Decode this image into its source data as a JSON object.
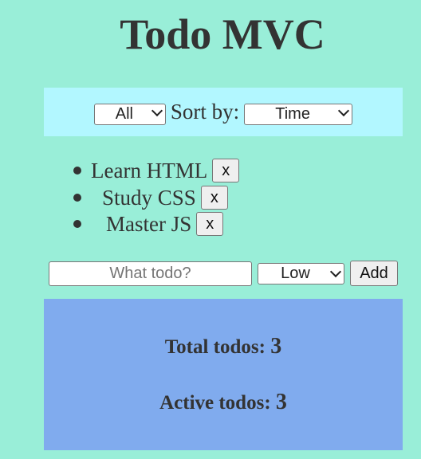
{
  "app": {
    "title": "Todo MVC"
  },
  "filter": {
    "selected": "All",
    "sort_label": "Sort by:",
    "sort_selected": "Time"
  },
  "todos": [
    {
      "text": "Learn HTML",
      "remove_label": "x"
    },
    {
      "text": "Study CSS",
      "remove_label": "x"
    },
    {
      "text": "Master JS",
      "remove_label": "x"
    }
  ],
  "add_form": {
    "placeholder": "What todo?",
    "value": "",
    "priority_selected": "Low",
    "add_label": "Add"
  },
  "stats": {
    "total_label": "Total todos:",
    "total_value": "3",
    "active_label": "Active todos:",
    "active_value": "3"
  },
  "colors": {
    "page_bg": "#99eed8",
    "filter_bg": "#b2f7ff",
    "stats_bg": "#80abee",
    "text": "#333333"
  },
  "icons": {
    "select_arrow": "chevron-down-icon",
    "bullet": "bullet-icon"
  }
}
